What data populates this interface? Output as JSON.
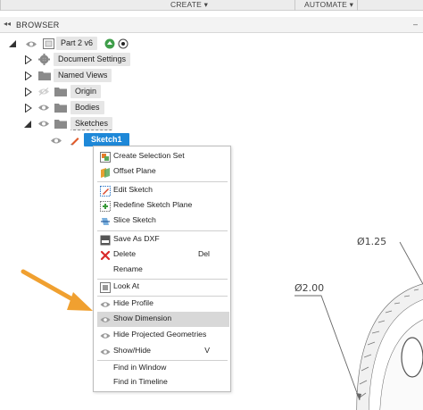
{
  "toolbar": {
    "create_label": "CREATE ▾",
    "automate_label": "AUTOMATE ▾"
  },
  "browser": {
    "collapse_glyph": "◂◂",
    "title": "BROWSER",
    "minimize_glyph": "–"
  },
  "tree": {
    "root": "Part 2 v6",
    "document_settings": "Document Settings",
    "named_views": "Named Views",
    "origin": "Origin",
    "bodies": "Bodies",
    "sketches": "Sketches",
    "sketch1": "Sketch1"
  },
  "menu": {
    "items": [
      {
        "label": "Create Selection Set",
        "icon": "selection-set-icon"
      },
      {
        "label": "Offset Plane",
        "icon": "offset-plane-icon"
      },
      {
        "label": "Edit Sketch",
        "icon": "edit-sketch-icon"
      },
      {
        "label": "Redefine Sketch Plane",
        "icon": "redefine-plane-icon"
      },
      {
        "label": "Slice Sketch",
        "icon": "slice-icon"
      },
      {
        "label": "Save As DXF",
        "icon": "dxf-icon"
      },
      {
        "label": "Delete",
        "icon": "delete-icon",
        "shortcut": "Del"
      },
      {
        "label": "Rename",
        "icon": ""
      },
      {
        "label": "Look At",
        "icon": "look-at-icon"
      },
      {
        "label": "Hide Profile",
        "icon": "eye-icon"
      },
      {
        "label": "Show Dimension",
        "icon": "eye-icon"
      },
      {
        "label": "Hide Projected Geometries",
        "icon": "eye-icon"
      },
      {
        "label": "Show/Hide",
        "icon": "eye-icon",
        "shortcut": "V"
      },
      {
        "label": "Find in Window",
        "icon": ""
      },
      {
        "label": "Find in Timeline",
        "icon": ""
      }
    ]
  },
  "canvas": {
    "dim_outer": "Ø1.25",
    "dim_inner": "Ø2.00"
  },
  "colors": {
    "selection_blue": "#1e88d8",
    "arrow_orange": "#f0a030",
    "delete_red": "#d92a2a"
  }
}
